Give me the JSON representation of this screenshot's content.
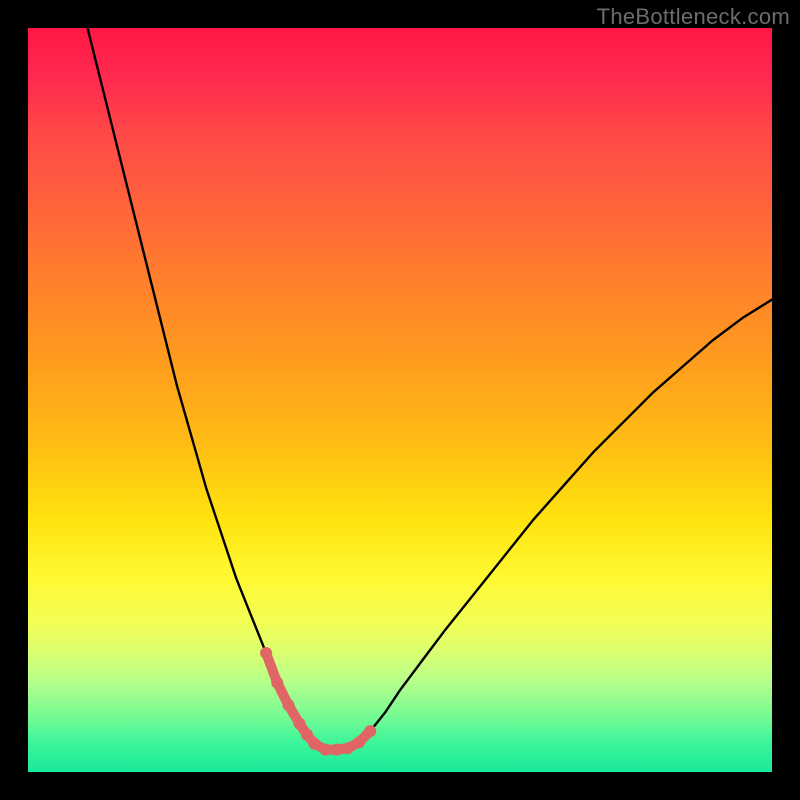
{
  "watermark": {
    "text": "TheBottleneck.com"
  },
  "colors": {
    "curve": "#000000",
    "marker": "#e06666",
    "background_black": "#000000"
  },
  "chart_data": {
    "type": "line",
    "title": "",
    "xlabel": "",
    "ylabel": "",
    "xlim": [
      0,
      100
    ],
    "ylim": [
      0,
      100
    ],
    "grid": false,
    "legend": false,
    "annotations": [],
    "series": [
      {
        "name": "black-curve",
        "stroke": "#000000",
        "x": [
          8,
          10,
          12,
          14,
          16,
          18,
          20,
          22,
          24,
          26,
          28,
          30,
          32,
          33.5,
          35,
          36.5,
          37.5,
          38.5,
          40,
          41.5,
          43,
          44.5,
          46,
          48,
          50,
          53,
          56,
          60,
          64,
          68,
          72,
          76,
          80,
          84,
          88,
          92,
          96,
          100
        ],
        "y": [
          100,
          92,
          84,
          76,
          68,
          60,
          52,
          45,
          38,
          32,
          26,
          21,
          16,
          12,
          9,
          6.5,
          5,
          3.8,
          3,
          3,
          3.2,
          4,
          5.5,
          8,
          11,
          15,
          19,
          24,
          29,
          34,
          38.5,
          43,
          47,
          51,
          54.5,
          58,
          61,
          63.5
        ]
      },
      {
        "name": "highlight-segment",
        "stroke": "#e06666",
        "marker": "circle",
        "x": [
          32,
          33.5,
          35,
          36.5,
          37.5,
          38.5,
          40,
          41.5,
          43,
          44.5,
          46
        ],
        "y": [
          16,
          12,
          9,
          6.5,
          5,
          3.8,
          3,
          3,
          3.2,
          4,
          5.5
        ]
      }
    ]
  }
}
